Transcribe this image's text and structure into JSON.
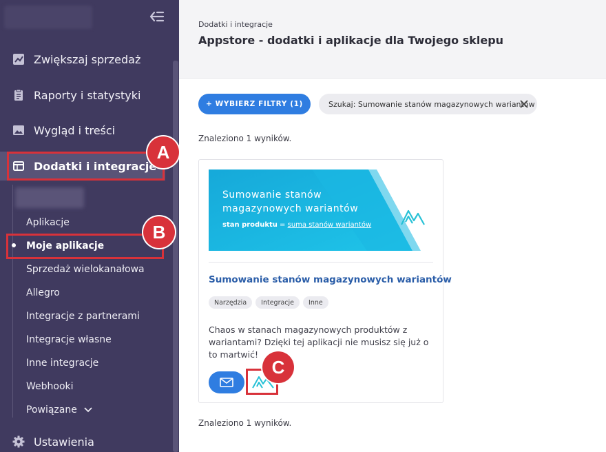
{
  "sidebar": {
    "main_items": [
      {
        "label": "Zwiększaj sprzedaż",
        "icon": "chart-line-icon"
      },
      {
        "label": "Raporty i statystyki",
        "icon": "clipboard-icon"
      },
      {
        "label": "Wygląd i treści",
        "icon": "image-icon"
      },
      {
        "label": "Dodatki i integracje",
        "icon": "window-icon"
      }
    ],
    "sub_items": [
      "Aplikacje",
      "Moje aplikacje",
      "Sprzedaż wielokanałowa",
      "Allegro",
      "Integracje z partnerami",
      "Integracje własne",
      "Inne integracje",
      "Webhooki",
      "Powiązane"
    ],
    "settings_label": "Ustawienia",
    "colors": {
      "bg": "#403a5f",
      "active": "#595377"
    }
  },
  "annotations": {
    "a": "A",
    "b": "B",
    "c": "C",
    "color": "#d8323a"
  },
  "header": {
    "breadcrumb": "Dodatki i integracje",
    "title": "Appstore - dodatki i aplikacje dla Twojego sklepu"
  },
  "filters": {
    "button_label": "+ WYBIERZ FILTRY (1)",
    "search_chip": "Szukaj: Sumowanie stanów magazynowych wariantów",
    "accent": "#2f7de1"
  },
  "results_text": "Znaleziono 1 wyników.",
  "card": {
    "banner": {
      "line1": "Sumowanie stanów",
      "line2": "magazynowych wariantów",
      "sub_bold": "stan produktu",
      "sub_eq": " = ",
      "sub_underline": "suma stanów wariantów"
    },
    "title": "Sumowanie stanów magazynowych wariantów",
    "tags": [
      "Narzędzia",
      "Integracje",
      "Inne"
    ],
    "description": "Chaos w stanach magazynowych produktów z wariantami? Dzięki tej aplikacji nie musisz się już o to martwić!",
    "contact_icon": "mail-icon",
    "app_icon": "app-logo-icon"
  }
}
